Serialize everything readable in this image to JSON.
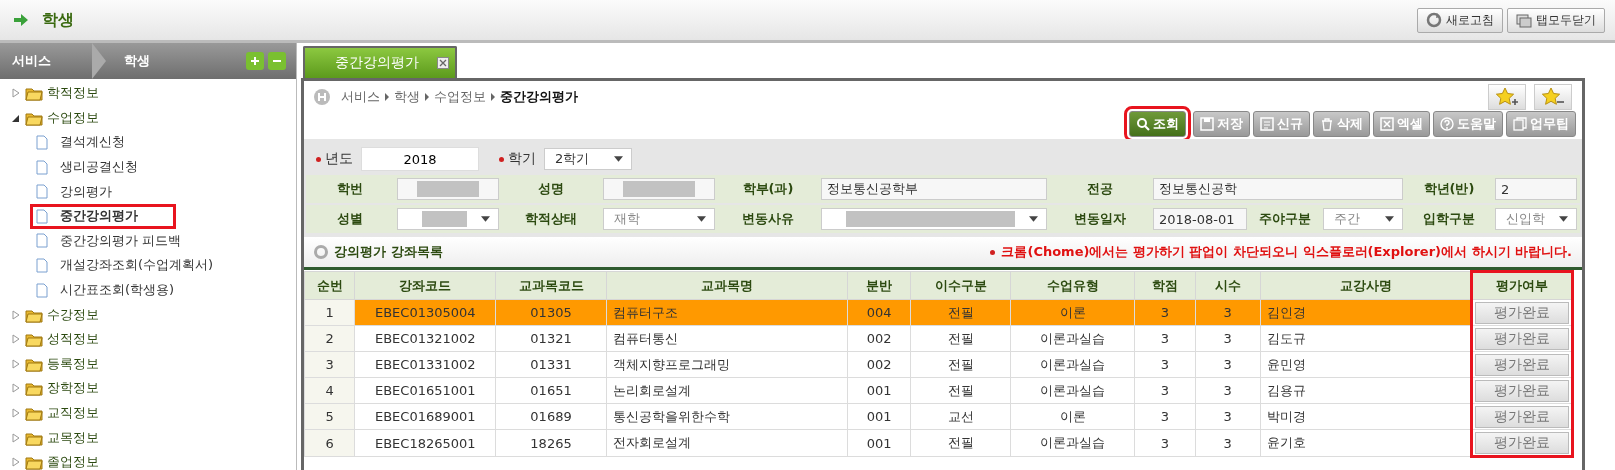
{
  "header": {
    "title": "학생",
    "buttons": [
      {
        "label": "새로고침",
        "kind": "refresh"
      },
      {
        "label": "탭모두닫기",
        "kind": "close-tabs"
      }
    ]
  },
  "sidebar": {
    "crumbs": [
      "서비스",
      "학생"
    ],
    "items": [
      {
        "label": "학적정보",
        "expanded": false
      },
      {
        "label": "수업정보",
        "expanded": true,
        "children": [
          {
            "label": "결석계신청",
            "highlighted": false
          },
          {
            "label": "생리공결신청",
            "highlighted": false
          },
          {
            "label": "강의평가",
            "highlighted": false
          },
          {
            "label": "중간강의평가",
            "highlighted": true
          },
          {
            "label": "중간강의평가 피드백",
            "highlighted": false
          },
          {
            "label": "개설강좌조회(수업계획서)",
            "highlighted": false
          },
          {
            "label": "시간표조회(학생용)",
            "highlighted": false
          }
        ]
      },
      {
        "label": "수강정보",
        "expanded": false
      },
      {
        "label": "성적정보",
        "expanded": false
      },
      {
        "label": "등록정보",
        "expanded": false
      },
      {
        "label": "장학정보",
        "expanded": false
      },
      {
        "label": "교직정보",
        "expanded": false
      },
      {
        "label": "교목정보",
        "expanded": false
      },
      {
        "label": "졸업정보",
        "expanded": false
      }
    ]
  },
  "tabs": [
    {
      "label": "중간강의평가",
      "selected": true
    }
  ],
  "breadcrumb": [
    "서비스",
    "학생",
    "수업정보",
    "중간강의평가"
  ],
  "toolbar": [
    {
      "label": "조회",
      "kind": "search",
      "primary": true,
      "highlighted": true
    },
    {
      "label": "저장",
      "kind": "save",
      "primary": false,
      "highlighted": false
    },
    {
      "label": "신규",
      "kind": "new",
      "primary": false,
      "highlighted": false
    },
    {
      "label": "삭제",
      "kind": "delete",
      "primary": false,
      "highlighted": false
    },
    {
      "label": "엑셀",
      "kind": "excel",
      "primary": false,
      "highlighted": false
    },
    {
      "label": "도움말",
      "kind": "help",
      "primary": false,
      "highlighted": false
    },
    {
      "label": "업무팁",
      "kind": "tip",
      "primary": false,
      "highlighted": false
    }
  ],
  "search": {
    "year_label": "년도",
    "year": "2018",
    "term_label": "학기",
    "term": "2학기"
  },
  "form": [
    [
      {
        "label": "학번",
        "kind": "redacted"
      },
      {
        "label": "성명",
        "kind": "redacted"
      },
      {
        "label": "학부(과)",
        "kind": "text",
        "value": "정보통신공학부"
      },
      {
        "label": "전공",
        "kind": "text",
        "value": "정보통신공학"
      },
      {
        "label": "학년(반)",
        "kind": "text",
        "value": "2"
      }
    ],
    [
      {
        "label": "성별",
        "kind": "redacted-select"
      },
      {
        "label": "학적상태",
        "kind": "select",
        "value": "재학",
        "disabled": true
      },
      {
        "label": "변동사유",
        "kind": "redacted-select"
      },
      {
        "label": "변동일자",
        "kind": "text",
        "value": "2018-08-01"
      },
      {
        "label": "주야구분",
        "kind": "select",
        "value": "주간",
        "disabled": true
      },
      {
        "label": "입학구분",
        "kind": "select",
        "value": "신입학",
        "disabled": true
      }
    ]
  ],
  "section_title": "강의평가 강좌목록",
  "notice": "크롬(Chome)에서는 평가하기 팝업이 차단되오니 익스플로러(Explorer)에서 하시기 바랍니다.",
  "table": {
    "columns": [
      {
        "label": "순번",
        "highlighted": false
      },
      {
        "label": "강좌코드",
        "highlighted": false
      },
      {
        "label": "교과목코드",
        "highlighted": false
      },
      {
        "label": "교과목명",
        "highlighted": false
      },
      {
        "label": "분반",
        "highlighted": false
      },
      {
        "label": "이수구분",
        "highlighted": false
      },
      {
        "label": "수업유형",
        "highlighted": false
      },
      {
        "label": "학점",
        "highlighted": false
      },
      {
        "label": "시수",
        "highlighted": false
      },
      {
        "label": "교강사명",
        "highlighted": false
      },
      {
        "label": "평가여부",
        "highlighted": true
      }
    ],
    "rows": [
      {
        "selected": true,
        "cells": [
          "1",
          "EBEC01305004",
          "01305",
          "컴퓨터구조",
          "004",
          "전필",
          "이론",
          "3",
          "3",
          "김인경",
          "평가완료"
        ]
      },
      {
        "selected": false,
        "cells": [
          "2",
          "EBEC01321002",
          "01321",
          "컴퓨터통신",
          "002",
          "전필",
          "이론과실습",
          "3",
          "3",
          "김도규",
          "평가완료"
        ]
      },
      {
        "selected": false,
        "cells": [
          "3",
          "EBEC01331002",
          "01331",
          "객체지향프로그래밍",
          "002",
          "전필",
          "이론과실습",
          "3",
          "3",
          "윤민영",
          "평가완료"
        ]
      },
      {
        "selected": false,
        "cells": [
          "4",
          "EBEC01651001",
          "01651",
          "논리회로설계",
          "001",
          "전필",
          "이론과실습",
          "3",
          "3",
          "김용규",
          "평가완료"
        ]
      },
      {
        "selected": false,
        "cells": [
          "5",
          "EBEC01689001",
          "01689",
          "통신공학을위한수학",
          "001",
          "교선",
          "이론",
          "3",
          "3",
          "박미경",
          "평가완료"
        ]
      },
      {
        "selected": false,
        "cells": [
          "6",
          "EBEC18265001",
          "18265",
          "전자회로설계",
          "001",
          "전필",
          "이론과실습",
          "3",
          "3",
          "윤기호",
          "평가완료"
        ]
      }
    ]
  }
}
